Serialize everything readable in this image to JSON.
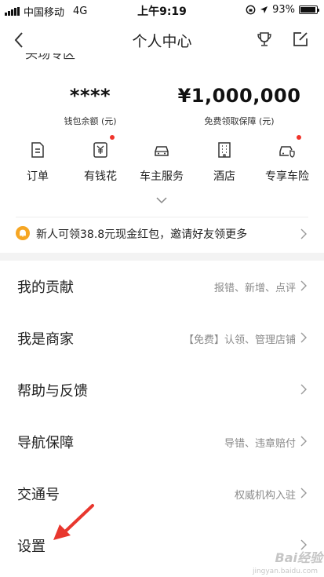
{
  "status_bar": {
    "carrier": "中国移动",
    "network": "4G",
    "time": "上午9:19",
    "battery": "93%",
    "battery_level": 0.93
  },
  "nav": {
    "title": "个人中心",
    "back_icon": "chevron-left-icon",
    "trophy_icon": "trophy-icon",
    "edit_icon": "edit-icon"
  },
  "partial_section_title": "头场专区",
  "wallet": {
    "balance": "****",
    "balance_label": "钱包余额 (元)",
    "coverage": "¥1,000,000",
    "coverage_label": "免费领取保障 (元)"
  },
  "quick_actions": [
    {
      "label": "订单",
      "icon": "document-icon",
      "badge": false
    },
    {
      "label": "有钱花",
      "icon": "yuan-icon",
      "badge": true
    },
    {
      "label": "车主服务",
      "icon": "car-icon",
      "badge": false
    },
    {
      "label": "酒店",
      "icon": "building-icon",
      "badge": false
    },
    {
      "label": "专享车险",
      "icon": "car-shield-icon",
      "badge": true
    }
  ],
  "promo": {
    "text": "新人可领38.8元现金红包，邀请好友领更多"
  },
  "menu": [
    {
      "label": "我的贡献",
      "sub": "报错、新增、点评"
    },
    {
      "label": "我是商家",
      "sub": "【免费】认领、管理店铺"
    },
    {
      "label": "帮助与反馈",
      "sub": ""
    },
    {
      "label": "导航保障",
      "sub": "导错、违章赔付"
    },
    {
      "label": "交通号",
      "sub": "权威机构入驻"
    },
    {
      "label": "设置",
      "sub": ""
    }
  ],
  "watermark": {
    "brand": "Bai经验",
    "url": "jingyan.baidu.com"
  },
  "colors": {
    "accent_red": "#f0342b",
    "bell_orange": "#f6a623",
    "annotation_red": "#e8372e"
  }
}
